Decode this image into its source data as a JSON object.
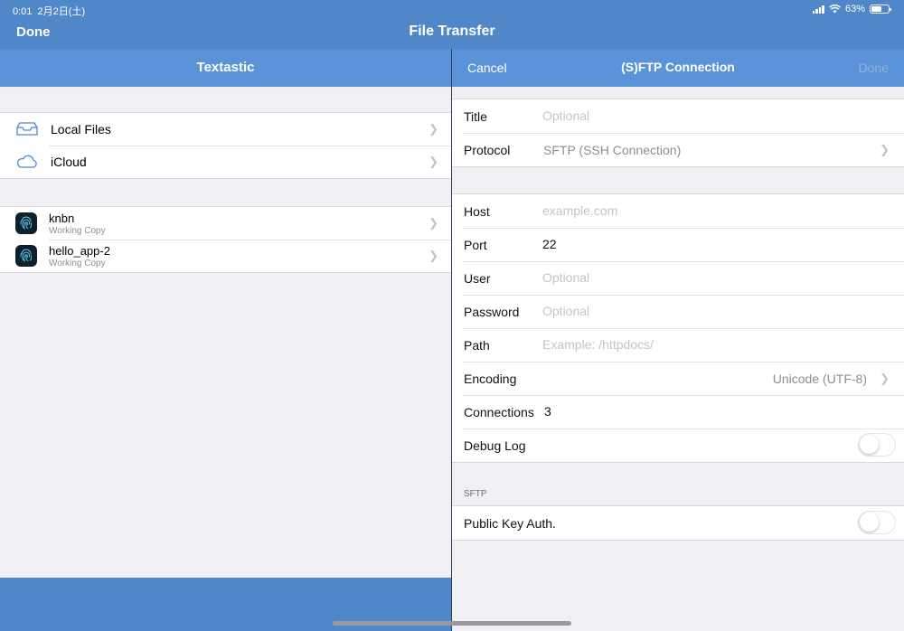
{
  "status_bar": {
    "time": "0:01",
    "date": "2月2日(土)",
    "battery": "63%",
    "battery_level": 0.63
  },
  "nav": {
    "done_label": "Done",
    "title": "File Transfer"
  },
  "sidebar": {
    "title": "Textastic",
    "locations": [
      {
        "label": "Local Files",
        "icon": "tray-icon"
      },
      {
        "label": "iCloud",
        "icon": "cloud-icon"
      }
    ],
    "repositories": [
      {
        "name": "knbn",
        "subtitle": "Working Copy",
        "icon": "fingerprint-icon"
      },
      {
        "name": "hello_app-2",
        "subtitle": "Working Copy",
        "icon": "fingerprint-icon"
      }
    ]
  },
  "connection": {
    "cancel_label": "Cancel",
    "title": "(S)FTP Connection",
    "done_label": "Done",
    "title_field": {
      "label": "Title",
      "value": "",
      "placeholder": "Optional"
    },
    "protocol": {
      "label": "Protocol",
      "value": "SFTP (SSH Connection)"
    },
    "host": {
      "label": "Host",
      "value": "",
      "placeholder": "example.com"
    },
    "port": {
      "label": "Port",
      "value": "22"
    },
    "user": {
      "label": "User",
      "value": "",
      "placeholder": "Optional"
    },
    "password": {
      "label": "Password",
      "value": "",
      "placeholder": "Optional"
    },
    "path": {
      "label": "Path",
      "value": "",
      "placeholder": "Example: /httpdocs/"
    },
    "encoding": {
      "label": "Encoding",
      "value": "Unicode (UTF-8)"
    },
    "connections": {
      "label": "Connections",
      "value": "3"
    },
    "debug_log": {
      "label": "Debug Log",
      "on": false
    },
    "sftp_section_title": "SFTP",
    "public_key_auth": {
      "label": "Public Key Auth.",
      "on": false
    }
  },
  "colors": {
    "nav_bar": "#4f87c9",
    "header": "#5a93d7",
    "background": "#efeff4"
  }
}
